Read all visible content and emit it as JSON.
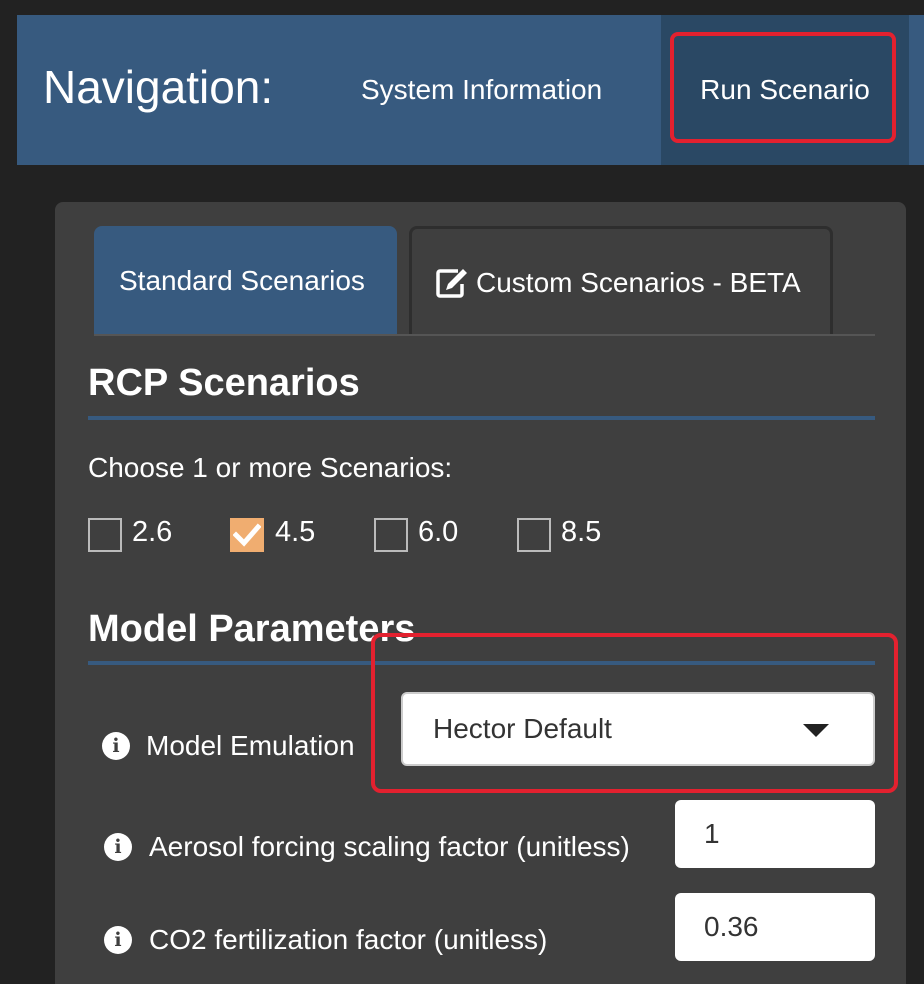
{
  "navbar": {
    "brand": "Navigation:",
    "items": [
      {
        "label": "System Information",
        "active": false
      },
      {
        "label": "Run Scenario",
        "active": true
      }
    ]
  },
  "tabs": [
    {
      "label": "Standard Scenarios",
      "active": true
    },
    {
      "label": "Custom Scenarios - BETA",
      "icon": "edit-icon",
      "active": false
    }
  ],
  "rcp": {
    "title": "RCP Scenarios",
    "prompt": "Choose 1 or more Scenarios:",
    "options": [
      {
        "label": "2.6",
        "checked": false
      },
      {
        "label": "4.5",
        "checked": true
      },
      {
        "label": "6.0",
        "checked": false
      },
      {
        "label": "8.5",
        "checked": false
      }
    ]
  },
  "model": {
    "title": "Model Parameters",
    "emulation": {
      "label": "Model Emulation",
      "selected": "Hector Default"
    },
    "aerosol": {
      "label": "Aerosol forcing scaling factor (unitless)",
      "value": "1"
    },
    "co2": {
      "label": "CO2 fertilization factor (unitless)",
      "value": "0.36"
    }
  },
  "colors": {
    "navbar": "#375a7f",
    "active_nav": "#2a4864",
    "highlight": "#e3212f",
    "checkbox_checked": "#f0ad70",
    "panel": "#3f3f3f",
    "background": "#222222"
  }
}
